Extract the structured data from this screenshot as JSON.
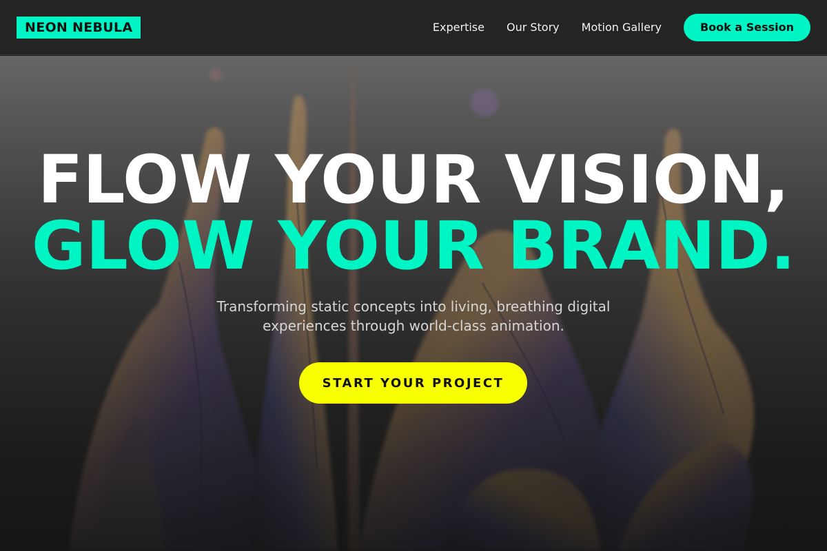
{
  "header": {
    "logo": "NEON NEBULA",
    "nav": [
      {
        "label": "Expertise"
      },
      {
        "label": "Our Story"
      },
      {
        "label": "Motion Gallery"
      }
    ],
    "cta_label": "Book a Session"
  },
  "hero": {
    "headline_line1": "FLOW YOUR VISION,",
    "headline_line2": "GLOW YOUR BRAND.",
    "subtitle": "Transforming static concepts into living, breathing digital experiences through world-class animation.",
    "cta_label": "START YOUR PROJECT",
    "background_image": "iridescent-liquid-splash"
  },
  "colors": {
    "accent": "#00f5c4",
    "cta_yellow": "#f7ff00",
    "header_bg": "#242424"
  }
}
